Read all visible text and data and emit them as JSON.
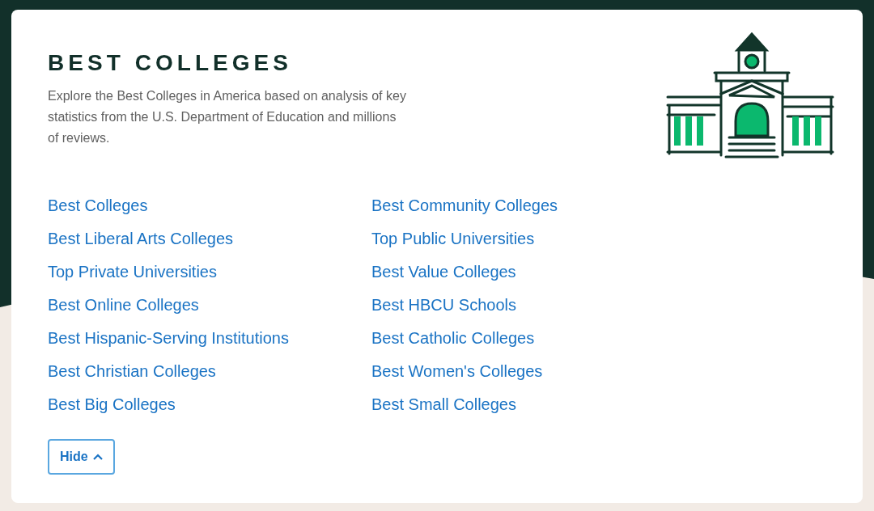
{
  "header": {
    "title": "BEST COLLEGES",
    "description": "Explore the Best Colleges in America based on analysis of key statistics from the U.S. Department of Education and millions of reviews."
  },
  "links": [
    {
      "label": "Best Colleges"
    },
    {
      "label": "Best Community Colleges"
    },
    {
      "label": "Best Liberal Arts Colleges"
    },
    {
      "label": "Top Public Universities"
    },
    {
      "label": "Top Private Universities"
    },
    {
      "label": "Best Value Colleges"
    },
    {
      "label": "Best Online Colleges"
    },
    {
      "label": "Best HBCU Schools"
    },
    {
      "label": "Best Hispanic-Serving Institutions"
    },
    {
      "label": "Best Catholic Colleges"
    },
    {
      "label": "Best Christian Colleges"
    },
    {
      "label": "Best Women's Colleges"
    },
    {
      "label": "Best Big Colleges"
    },
    {
      "label": "Best Small Colleges"
    }
  ],
  "toggle": {
    "label": "Hide",
    "expanded": true
  }
}
